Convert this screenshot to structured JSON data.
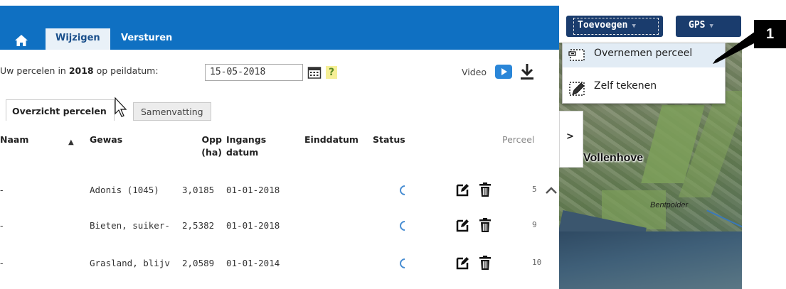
{
  "header": {
    "tabs": [
      {
        "label": "Wijzigen",
        "active": true
      },
      {
        "label": "Versturen",
        "active": false
      }
    ]
  },
  "info": {
    "prefix": "Uw percelen in ",
    "year": "2018",
    "suffix": " op peildatum:",
    "date_value": "15-05-2018",
    "help_label": "?",
    "video_label": "Video"
  },
  "subtabs": [
    {
      "label": "Overzicht percelen",
      "active": true
    },
    {
      "label": "Samenvatting",
      "active": false
    }
  ],
  "table": {
    "headers": {
      "naam": "Naam",
      "gewas": "Gewas",
      "opp": "Opp",
      "opp_unit": "(ha)",
      "ingangs": "Ingangs",
      "datum": "datum",
      "einddatum": "Einddatum",
      "status": "Status",
      "perceel": "Perceel"
    },
    "rows": [
      {
        "naam": "-",
        "gewas": "Adonis (1045)",
        "opp": "3,0185",
        "ingangsdatum": "01-01-2018",
        "einddatum": "",
        "perceel": "5"
      },
      {
        "naam": "-",
        "gewas": "Bieten, suiker-",
        "opp": "2,5382",
        "ingangsdatum": "01-01-2018",
        "einddatum": "",
        "perceel": "9"
      },
      {
        "naam": "-",
        "gewas": "Grasland, blijv",
        "opp": "2,0589",
        "ingangsdatum": "01-01-2014",
        "einddatum": "",
        "perceel": "10"
      }
    ]
  },
  "map": {
    "add_button": "Toevoegen",
    "gps_button": "GPS",
    "panel_toggle": ">",
    "dropdown_items": [
      {
        "label": "Overnemen perceel",
        "icon": "copy-parcel-icon",
        "highlighted": true
      },
      {
        "label": "Zelf tekenen",
        "icon": "draw-pencil-icon",
        "highlighted": false
      }
    ],
    "town_label": "Vollenhove",
    "polder_label": "Bentpolder"
  },
  "callout": {
    "label": "1"
  },
  "colors": {
    "header_blue": "#0f70c2",
    "button_navy": "#1a3c6d",
    "highlight": "#e2ecf5"
  }
}
